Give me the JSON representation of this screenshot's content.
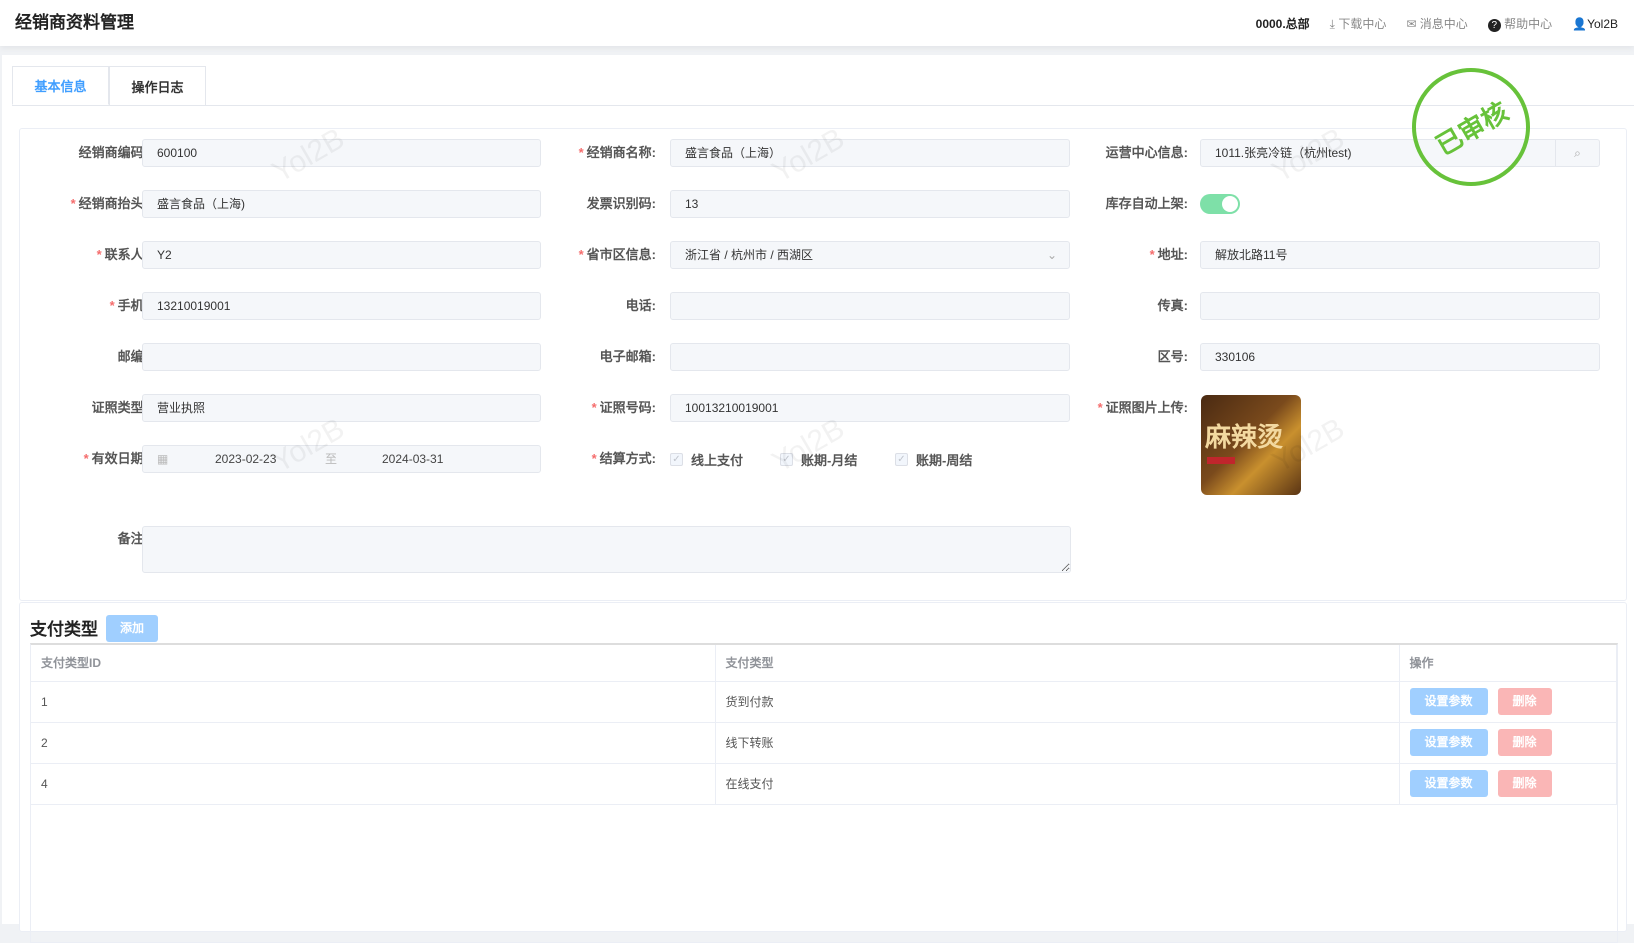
{
  "header": {
    "title": "经销商资料管理",
    "org": "0000.总部",
    "download": "下载中心",
    "messages": "消息中心",
    "help": "帮助中心",
    "user": "Yol2B"
  },
  "tabs": [
    {
      "label": "基本信息"
    },
    {
      "label": "操作日志"
    }
  ],
  "stamp": "已审核",
  "watermark": "Yol2B",
  "form": {
    "dealer_code": {
      "label": "经销商编码:",
      "value": "600100"
    },
    "dealer_name": {
      "label": "经销商名称:",
      "value": "盛言食品（上海）"
    },
    "ops_center": {
      "label": "运营中心信息:",
      "value": "1011.张亮冷链（杭州test)"
    },
    "dealer_header": {
      "label": "经销商抬头:",
      "value": "盛言食品（上海)"
    },
    "invoice_id": {
      "label": "发票识别码:",
      "value": "13"
    },
    "auto_shelf": {
      "label": "库存自动上架:",
      "on": true
    },
    "contact": {
      "label": "联系人:",
      "value": "Y2"
    },
    "region": {
      "label": "省市区信息:",
      "value": "浙江省 / 杭州市 / 西湖区"
    },
    "address": {
      "label": "地址:",
      "value": "解放北路11号"
    },
    "mobile": {
      "label": "手机:",
      "value": "13210019001"
    },
    "phone": {
      "label": "电话:",
      "value": ""
    },
    "fax": {
      "label": "传真:",
      "value": ""
    },
    "postcode": {
      "label": "邮编:",
      "value": ""
    },
    "email": {
      "label": "电子邮箱:",
      "value": ""
    },
    "area_code": {
      "label": "区号:",
      "value": "330106"
    },
    "license_type": {
      "label": "证照类型:",
      "value": "营业执照"
    },
    "license_no": {
      "label": "证照号码:",
      "value": "10013210019001"
    },
    "license_image": {
      "label": "证照图片上传:",
      "image_text": "麻辣烫"
    },
    "valid_date": {
      "label": "有效日期:",
      "start": "2023-02-23",
      "sep": "至",
      "end": "2024-03-31"
    },
    "settlement": {
      "label": "结算方式:",
      "options": [
        "线上支付",
        "账期-月结",
        "账期-周结"
      ]
    },
    "remark": {
      "label": "备注:",
      "value": ""
    }
  },
  "payment": {
    "title": "支付类型",
    "add": "添加",
    "columns": [
      "支付类型ID",
      "支付类型",
      "操作"
    ],
    "rows": [
      {
        "id": "1",
        "type": "货到付款"
      },
      {
        "id": "2",
        "type": "线下转账"
      },
      {
        "id": "4",
        "type": "在线支付"
      }
    ],
    "set_params": "设置参数",
    "delete": "删除"
  }
}
